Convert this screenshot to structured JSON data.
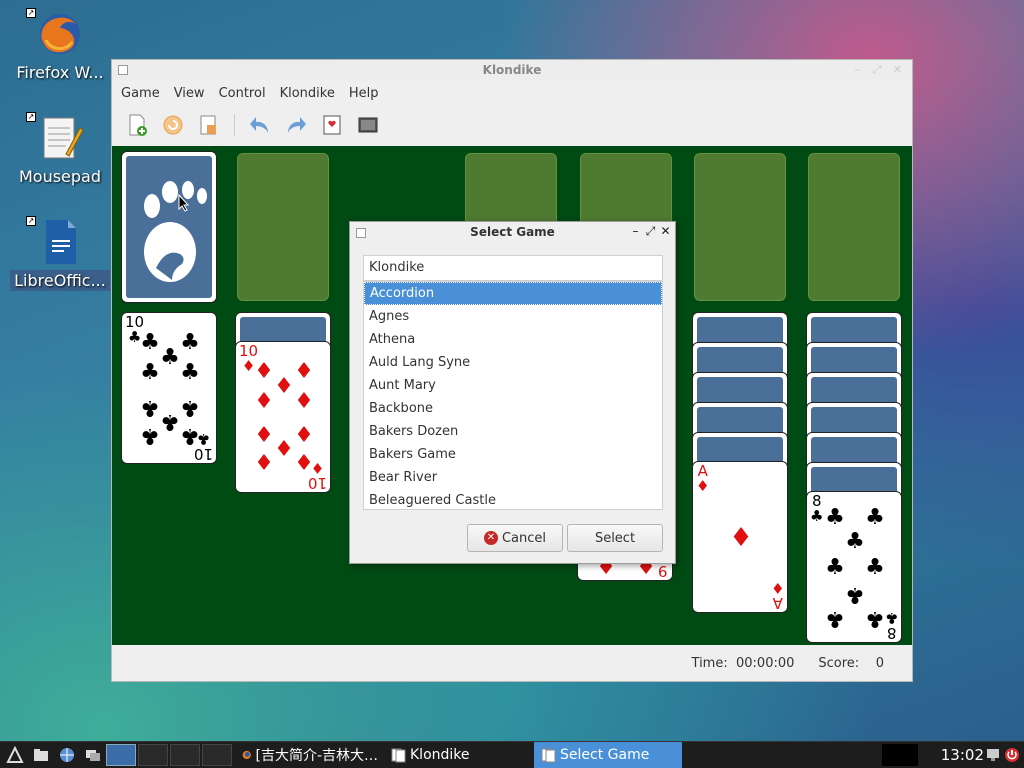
{
  "desktop": {
    "icons": [
      {
        "label": "Firefox W...",
        "icon": "firefox-icon"
      },
      {
        "label": "Mousepad",
        "icon": "notepad-icon"
      },
      {
        "label": "LibreOffic...",
        "icon": "writer-doc-icon"
      }
    ]
  },
  "window": {
    "title": "Klondike",
    "menu": [
      "Game",
      "View",
      "Control",
      "Klondike",
      "Help"
    ],
    "toolbar": [
      "new-game-icon",
      "restart-icon",
      "hint-icon",
      "undo-icon",
      "redo-icon",
      "deal-icon",
      "fullscreen-icon"
    ],
    "status": {
      "time_label": "Time:",
      "time_value": "00:00:00",
      "score_label": "Score:",
      "score_value": "0"
    }
  },
  "cards": {
    "col1": {
      "rank": "10",
      "suit": "♣"
    },
    "col2": {
      "rank": "10",
      "suit": "♦"
    },
    "col5": {
      "rank": "9",
      "suit": "♦"
    },
    "col6": {
      "rank": "A",
      "suit": "♦"
    },
    "col7": {
      "rank": "8",
      "suit": "♣"
    }
  },
  "dialog": {
    "title": "Select Game",
    "search_value": "Klondike",
    "games": [
      "Accordion",
      "Agnes",
      "Athena",
      "Auld Lang Syne",
      "Aunt Mary",
      "Backbone",
      "Bakers Dozen",
      "Bakers Game",
      "Bear River",
      "Beleaguered Castle"
    ],
    "selected": "Accordion",
    "cancel_label": "Cancel",
    "select_label": "Select"
  },
  "taskbar": {
    "tasks": [
      {
        "label": "[吉大简介-吉林大…",
        "icon": "firefox-icon"
      },
      {
        "label": "Klondike",
        "icon": "cards-icon"
      },
      {
        "label": "Select Game",
        "icon": "cards-icon"
      }
    ],
    "clock": "13:02"
  }
}
